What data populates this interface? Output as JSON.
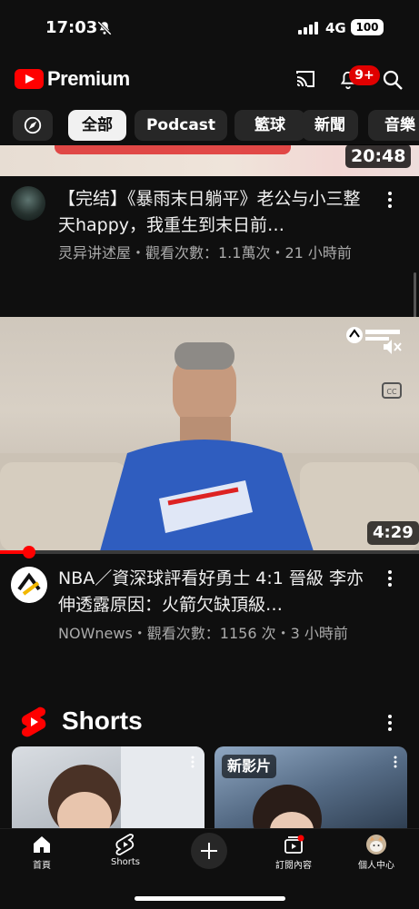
{
  "status_bar": {
    "time": "17:03",
    "network": "4G",
    "battery": "100"
  },
  "header": {
    "brand": "Premium",
    "notification_count": "9+"
  },
  "chips": [
    "全部",
    "Podcast",
    "籃球",
    "新聞",
    "音樂"
  ],
  "videos": [
    {
      "title": "【完结】《暴雨末日躺平》老公与小三整天happy，我重生到末日前…",
      "meta": "灵异讲述屋・觀看次數：1.1萬次・21 小時前",
      "duration": "20:48"
    },
    {
      "title": "NBA／資深球評看好勇士 4:1 晉級 李亦伸透露原因：火箭欠缺頂級…",
      "meta": "NOWnews・觀看次數：1156 次・3 小時前",
      "duration": "4:29",
      "progress": 0.07
    }
  ],
  "shorts": {
    "title": "Shorts",
    "second_badge": "新影片"
  },
  "nav": [
    {
      "label": "首頁",
      "icon": "home-icon"
    },
    {
      "label": "Shorts",
      "icon": "shorts-icon"
    },
    {
      "label": "",
      "icon": "create-icon"
    },
    {
      "label": "訂閱內容",
      "icon": "subscriptions-icon"
    },
    {
      "label": "個人中心",
      "icon": "avatar-icon"
    }
  ],
  "colors": {
    "accent": "#ff0000",
    "background": "#0f0f0f",
    "chip_bg": "#272727",
    "active_chip": "#f1f1f1"
  }
}
